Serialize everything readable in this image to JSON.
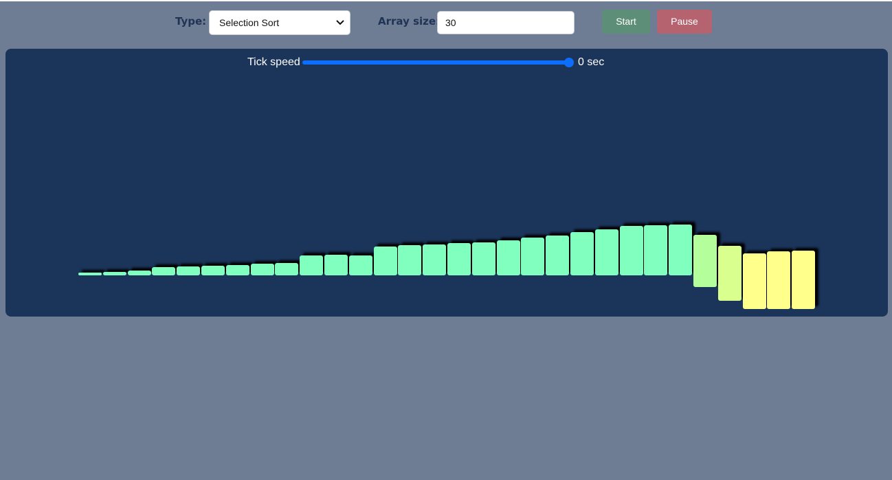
{
  "toolbar": {
    "type_label": "Type:",
    "type_value": "Selection Sort",
    "size_label": "Array size:",
    "size_value": "30",
    "start_label": "Start",
    "pause_label": "Pause"
  },
  "speed": {
    "label": "Tick speed",
    "value": "0 sec",
    "slider_fraction": 1.0
  },
  "colors": {
    "background": "#6e7c94",
    "panel": "#1b3459",
    "bar_sorted": "#80ffbe",
    "bar_mid": "#b4ff9c",
    "bar_active": "#d9ff8e",
    "bar_yellow": "#ffff8c",
    "start_button": "#5d8f78",
    "pause_button": "#b5636e",
    "slider": "#0d6efd"
  },
  "chart_data": {
    "type": "bar",
    "values": [
      4,
      6,
      8,
      14,
      15,
      16,
      17,
      19,
      20,
      33,
      34,
      33,
      48,
      50,
      51,
      54,
      55,
      58,
      63,
      66,
      72,
      77,
      82,
      83,
      84,
      87,
      91,
      93,
      96,
      97
    ],
    "states": [
      "sorted",
      "sorted",
      "sorted",
      "sorted",
      "sorted",
      "sorted",
      "sorted",
      "sorted",
      "sorted",
      "sorted",
      "sorted",
      "sorted",
      "sorted",
      "sorted",
      "sorted",
      "sorted",
      "sorted",
      "sorted",
      "sorted",
      "sorted",
      "sorted",
      "sorted",
      "sorted",
      "sorted",
      "sorted",
      "mid",
      "active",
      "yellow",
      "yellow",
      "yellow"
    ]
  }
}
